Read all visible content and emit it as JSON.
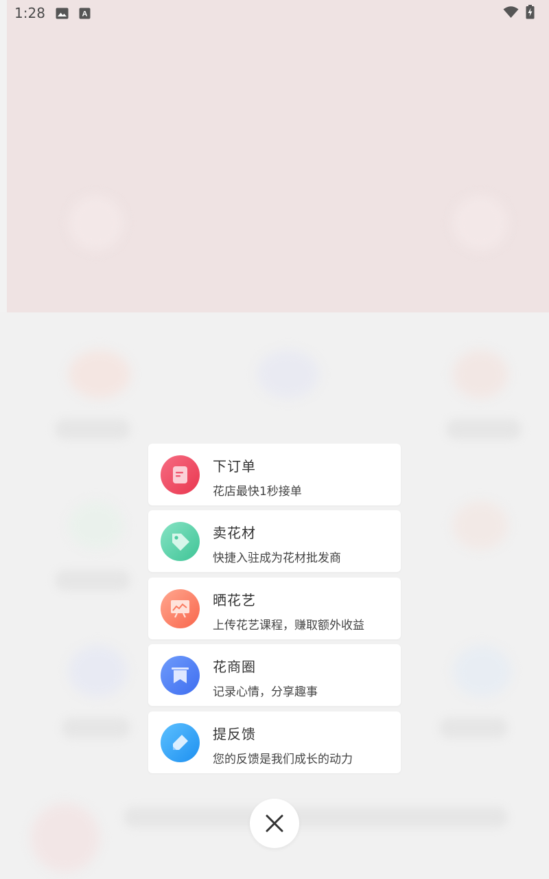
{
  "status_bar": {
    "time": "1:28",
    "icons": [
      "image-icon",
      "a-font-icon",
      "wifi-icon",
      "battery-charging-icon"
    ]
  },
  "menu": {
    "items": [
      {
        "title": "下订单",
        "subtitle": "花店最快1秒接单",
        "icon": "order-doc-icon",
        "color": "#ef4a68"
      },
      {
        "title": "卖花材",
        "subtitle": "快捷入驻成为花材批发商",
        "icon": "price-tag-icon",
        "color": "#55cfa6"
      },
      {
        "title": "晒花艺",
        "subtitle": "上传花艺课程，赚取额外收益",
        "icon": "presentation-board-icon",
        "color": "#fb7c62"
      },
      {
        "title": "花商圈",
        "subtitle": "记录心情，分享趣事",
        "icon": "bookmark-icon",
        "color": "#4d7ef6"
      },
      {
        "title": "提反馈",
        "subtitle": "您的反馈是我们成长的动力",
        "icon": "pencil-edit-icon",
        "color": "#2ea6f8"
      }
    ]
  },
  "close": {
    "icon": "close-icon"
  }
}
